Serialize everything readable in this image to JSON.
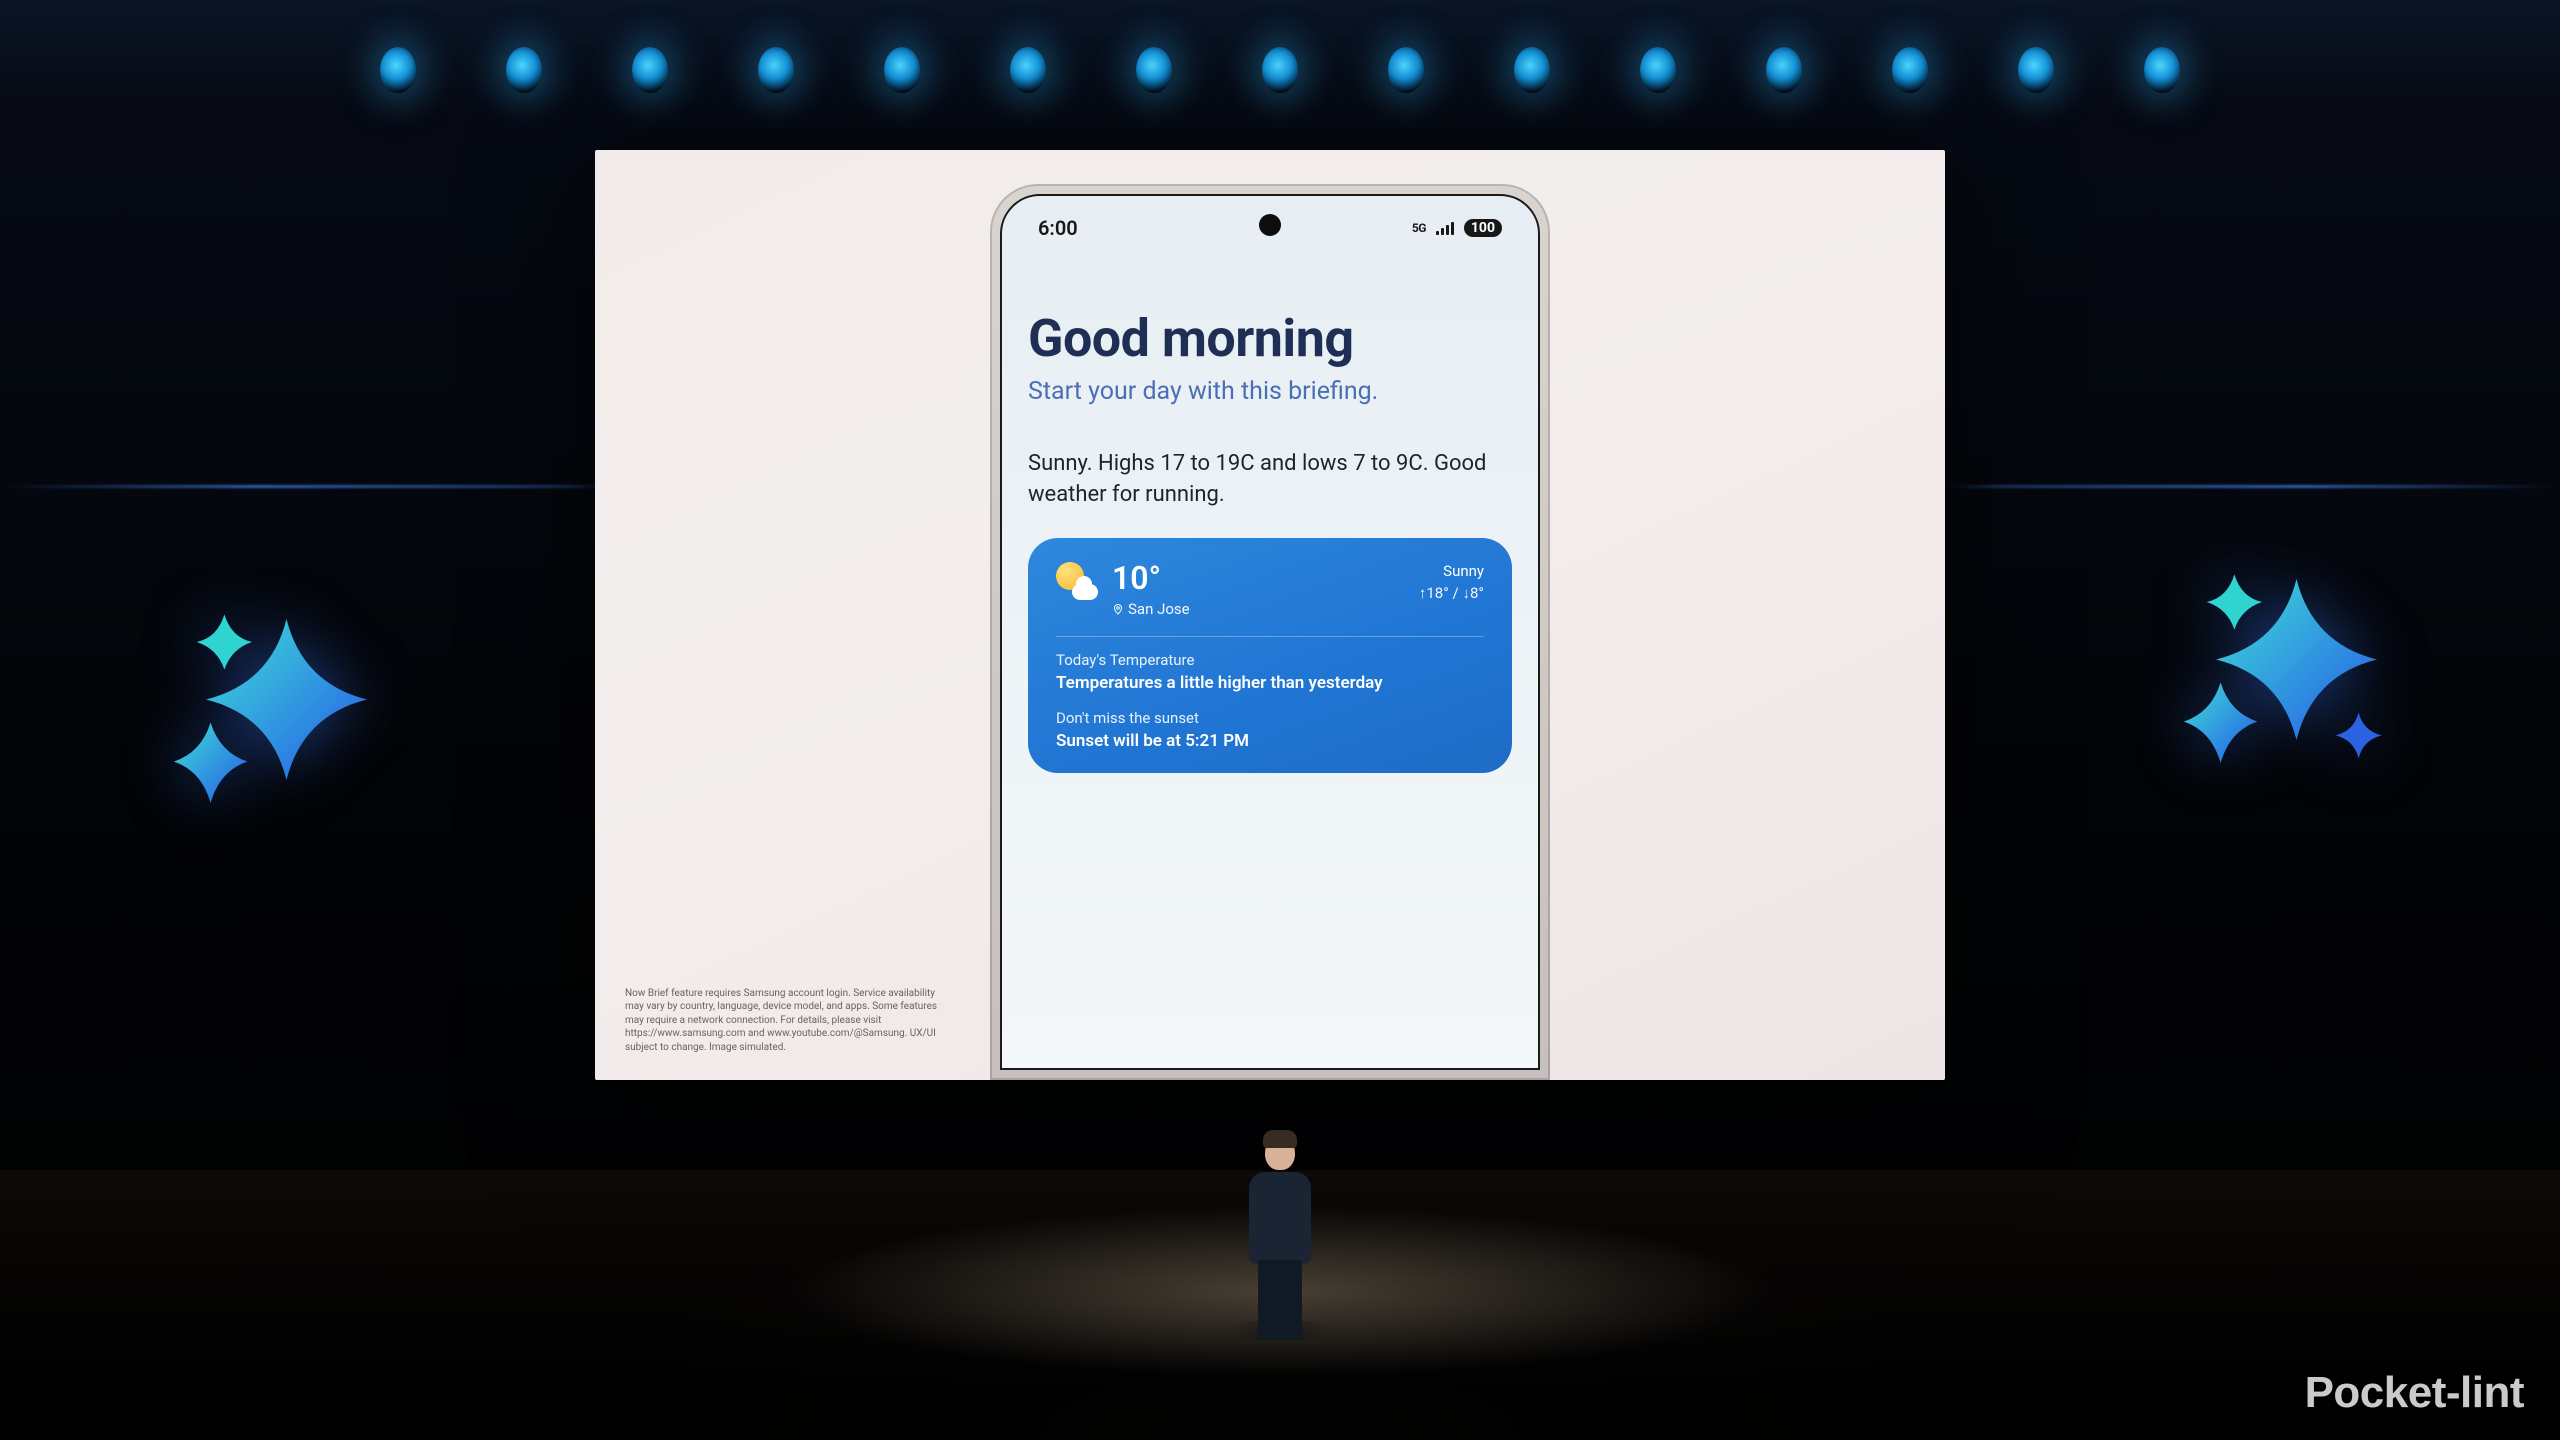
{
  "watermark": "Pocket-lint",
  "screen": {
    "disclaimer": "Now Brief feature requires Samsung account login. Service availability may vary by country, language, device model, and apps. Some features may require a network connection. For details, please visit https://www.samsung.com and www.youtube.com/@Samsung. UX/UI subject to change. Image simulated."
  },
  "phone": {
    "status": {
      "time": "6:00",
      "network": "5G",
      "battery": "100"
    },
    "greeting": {
      "title": "Good morning",
      "subtitle": "Start your day with this briefing."
    },
    "summary": "Sunny. Highs 17 to 19C and lows 7 to 9C. Good weather for running.",
    "weather": {
      "temp": "10°",
      "location": "San Jose",
      "condition": "Sunny",
      "hilo": "↑18° / ↓8°",
      "today_label": "Today's Temperature",
      "today_body": "Temperatures a little higher than yesterday",
      "sunset_label": "Don't miss the sunset",
      "sunset_body": "Sunset will be at 5:21 PM"
    }
  }
}
